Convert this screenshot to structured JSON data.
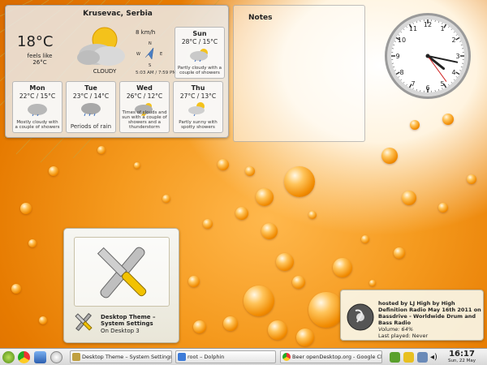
{
  "weather": {
    "city": "Krusevac, Serbia",
    "temperature": "18°C",
    "feels_like_label": "feels like",
    "feels_like_value": "26°C",
    "condition": "CLOUDY",
    "wind_speed": "8 km/h",
    "compass": {
      "n": "N",
      "s": "S",
      "e": "E",
      "w": "W"
    },
    "sun_times": "5:03 AM / 7:59 PM",
    "forecast": [
      {
        "day": "Sun",
        "temps": "28°C / 15°C",
        "desc": "Partly cloudy with a couple of showers"
      },
      {
        "day": "Mon",
        "temps": "22°C / 15°C",
        "desc": "Mostly cloudy with a couple of showers"
      },
      {
        "day": "Tue",
        "temps": "23°C / 14°C",
        "desc": "Periods of rain"
      },
      {
        "day": "Wed",
        "temps": "26°C / 12°C",
        "desc": "Times of clouds and sun with a couple of showers and a thunderstorm"
      },
      {
        "day": "Thu",
        "temps": "27°C / 13°C",
        "desc": "Partly sunny with spotty showers"
      }
    ]
  },
  "notes": {
    "title": "Notes"
  },
  "clock": {
    "hour": 4,
    "minute": 17,
    "second": 24
  },
  "theme_widget": {
    "title": "Desktop Theme – System Settings",
    "subtitle": "On Desktop 3"
  },
  "radio": {
    "line1": "hosted by LJ High by High Definition Radio May 16th 2011 on Bassdrive - Worldwide Drum and Bass Radio",
    "volume": "Volume: 64%",
    "last_played": "Last played: Never"
  },
  "taskbar": {
    "tasks": [
      {
        "label": "Desktop Theme – System Settings"
      },
      {
        "label": "root – Dolphin"
      },
      {
        "label": "Beer openDesktop.org - Google Chrome"
      }
    ],
    "time": "16:17",
    "date": "Sun, 22 May"
  },
  "colors": {
    "accent": "#f08a00",
    "panel": "#ebebeb"
  }
}
